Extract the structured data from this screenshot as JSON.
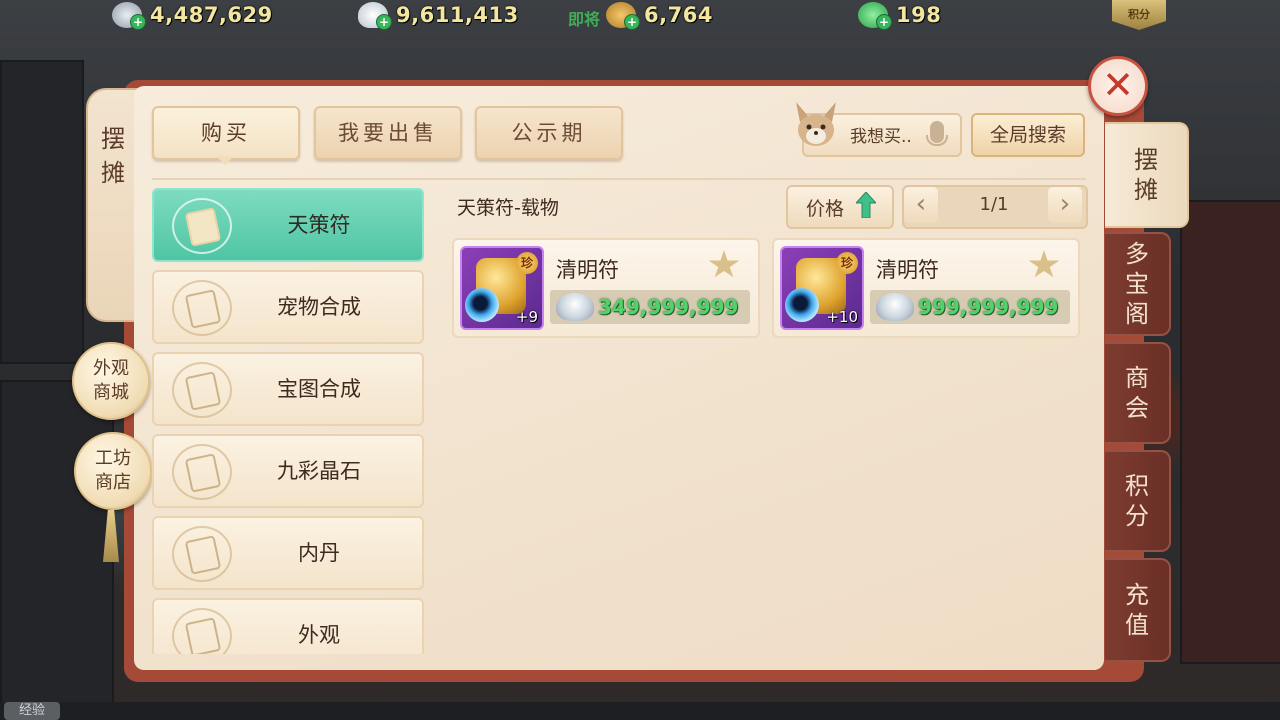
{
  "currencies": [
    {
      "icon": "coin-stack-icon",
      "value": "4,487,629"
    },
    {
      "icon": "silver-ingot-icon",
      "value": "9,611,413"
    },
    {
      "icon": "copper-coin-icon",
      "value": "6,764",
      "hint": "即将"
    },
    {
      "icon": "jade-icon",
      "value": "198"
    }
  ],
  "points_badge": "积分",
  "left_strip": {
    "label": "摆摊"
  },
  "side_buttons": [
    {
      "label": "外观商城"
    },
    {
      "label": "工坊商店"
    }
  ],
  "tabs": [
    {
      "label": "购买",
      "active": true
    },
    {
      "label": "我要出售",
      "active": false
    },
    {
      "label": "公示期",
      "active": false
    }
  ],
  "wish": {
    "label": "我想买.."
  },
  "global_search": {
    "label": "全局搜索"
  },
  "categories": [
    {
      "label": "天策符",
      "active": true
    },
    {
      "label": "宠物合成",
      "active": false
    },
    {
      "label": "宝图合成",
      "active": false
    },
    {
      "label": "九彩晶石",
      "active": false
    },
    {
      "label": "内丹",
      "active": false
    },
    {
      "label": "外观",
      "active": false
    }
  ],
  "content": {
    "title": "天策符-载物",
    "sort_label": "价格",
    "page": "1/1",
    "listings": [
      {
        "name": "清明符",
        "level": "+9",
        "rarity": "珍",
        "price": "349,999,999"
      },
      {
        "name": "清明符",
        "level": "+10",
        "rarity": "珍",
        "price": "999,999,999"
      }
    ]
  },
  "right_tabs": [
    {
      "label": "摆摊",
      "active": true
    },
    {
      "label": "多宝阁",
      "active": false
    },
    {
      "label": "商会",
      "active": false
    },
    {
      "label": "积分",
      "active": false
    },
    {
      "label": "充值",
      "active": false
    }
  ],
  "exp_label": "经验",
  "colors": {
    "accent_teal": "#4fc5a4",
    "price_green": "#4fd36a",
    "frame_red": "#a54a36",
    "rare_purple": "#8c3fb8"
  }
}
